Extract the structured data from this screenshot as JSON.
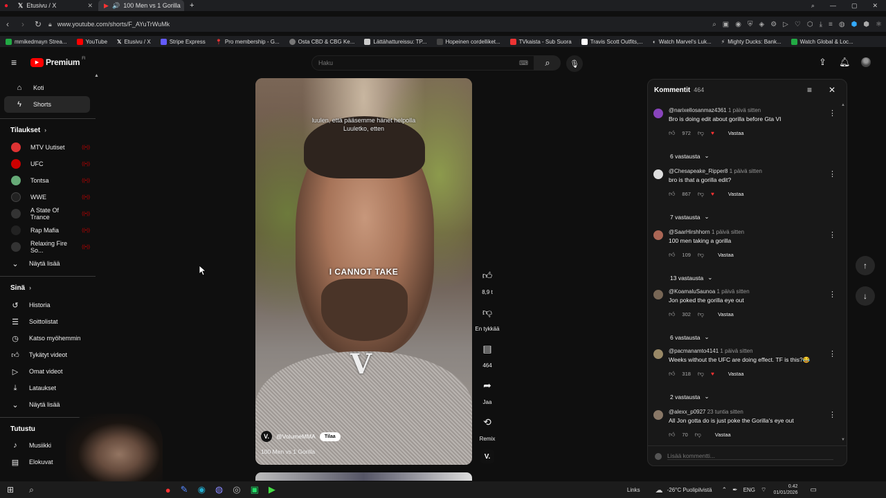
{
  "browser": {
    "tabs": [
      {
        "label": "Etusivu / X",
        "active": false
      },
      {
        "label": "100 Men vs 1 Gorilla",
        "active": true
      }
    ],
    "url": "www.youtube.com/shorts/F_AYuTrWuMk",
    "bookmarks": [
      {
        "label": "mmikedmayn Strea...",
        "color": "#22aa44"
      },
      {
        "label": "YouTube",
        "color": "#ff0000"
      },
      {
        "label": "Etusivu / X",
        "color": "#ffffff"
      },
      {
        "label": "Stripe Express",
        "color": "#635bff"
      },
      {
        "label": "Pro membership - G...",
        "color": "#e33"
      },
      {
        "label": "Osta CBD & CBG Ke...",
        "color": "#777"
      },
      {
        "label": "Lättähattureissu: TP...",
        "color": "#ccc"
      },
      {
        "label": "Hopeinen cordelliket...",
        "color": "#333"
      },
      {
        "label": "TVkaista - Sub Suora",
        "color": "#e33"
      },
      {
        "label": "Travis Scott Outfits,...",
        "color": "#fff"
      },
      {
        "label": "Watch Marvel's Luk...",
        "color": "#ccc"
      },
      {
        "label": "Mighty Ducks: Bank...",
        "color": "#ccc"
      },
      {
        "label": "Watch Global & Loc...",
        "color": "#2a4"
      }
    ]
  },
  "youtube": {
    "logo_text": "Premium",
    "logo_sup": "FI",
    "search_placeholder": "Haku"
  },
  "sidebar": {
    "main": [
      {
        "label": "Koti",
        "icon": "home-icon",
        "active": false
      },
      {
        "label": "Shorts",
        "icon": "shorts-icon",
        "active": true
      }
    ],
    "subs_heading": "Tilaukset",
    "subs": [
      {
        "label": "MTV Uutiset",
        "color": "#d33"
      },
      {
        "label": "UFC",
        "color": "#c00"
      },
      {
        "label": "Tontsa",
        "color": "#6a7"
      },
      {
        "label": "WWE",
        "color": "#222"
      },
      {
        "label": "A State Of Trance",
        "color": "#333"
      },
      {
        "label": "Rap Mafia",
        "color": "#222"
      },
      {
        "label": "Relaxing Fire So...",
        "color": "#333"
      }
    ],
    "show_more": "Näytä lisää",
    "you_heading": "Sinä",
    "you": [
      {
        "label": "Historia",
        "icon": "history-icon"
      },
      {
        "label": "Soittolistat",
        "icon": "playlist-icon"
      },
      {
        "label": "Katso myöhemmin",
        "icon": "clock-icon"
      },
      {
        "label": "Tykätyt videot",
        "icon": "like-icon"
      },
      {
        "label": "Omat videot",
        "icon": "video-icon"
      },
      {
        "label": "Lataukset",
        "icon": "download-icon"
      }
    ],
    "show_more_2": "Näytä lisää",
    "explore_heading": "Tutustu",
    "explore": [
      {
        "label": "Musiikki",
        "icon": "music-icon"
      },
      {
        "label": "Elokuvat",
        "icon": "film-icon"
      }
    ]
  },
  "video": {
    "subtitle_line1": "luulen, että pääsemme hänet helpolla",
    "subtitle_line2": "Luuletko, etten",
    "caption": "I CANNOT TAKE",
    "channel": "@VolumeMMA",
    "subscribe": "Tilaa",
    "title": "100 Men vs 1 Gorilla"
  },
  "actions": {
    "likes": "8,9 t",
    "dislike": "En tykkää",
    "comments": "464",
    "share": "Jaa",
    "remix": "Remix"
  },
  "comments_panel": {
    "title": "Kommentit",
    "count": "464",
    "add_placeholder": "Lisää kommentti...",
    "reply_label": "Vastaa",
    "items": [
      {
        "author": "@narixellosanmaz4361",
        "time": "1 päivä sitten",
        "text": "Bro is doing edit about gorilla before Gta VI",
        "likes": "972",
        "replies": "6 vastausta",
        "heart": true,
        "color": "#8844bb"
      },
      {
        "author": "@Chesapeake_Ripper8",
        "time": "1 päivä sitten",
        "text": "bro is that a gorilla edit?",
        "likes": "867",
        "replies": "7 vastausta",
        "heart": true,
        "color": "#dddddd"
      },
      {
        "author": "@SaarHirshhorn",
        "time": "1 päivä sitten",
        "text": "100 men taking a gorilla",
        "likes": "109",
        "replies": "13 vastausta",
        "heart": false,
        "color": "#aa6655"
      },
      {
        "author": "@KoamaluSaunoa",
        "time": "1 päivä sitten",
        "text": "Jon poked the gorilla eye out",
        "likes": "302",
        "replies": "6 vastausta",
        "heart": false,
        "color": "#776655"
      },
      {
        "author": "@pacmanamto4141",
        "time": "1 päivä sitten",
        "text": "Weeks without the UFC are doing effect. TF is this?😂",
        "likes": "318",
        "replies": "2 vastausta",
        "heart": true,
        "color": "#998866"
      },
      {
        "author": "@alexx_p0927",
        "time": "23 tuntia sitten",
        "text": "All Jon gotta do is just poke the Gorilla's eye out",
        "likes": "70",
        "replies": "",
        "heart": false,
        "color": "#887766"
      }
    ]
  },
  "taskbar": {
    "links": "Links",
    "weather": "-26°C Puolipilvistä",
    "lang": "ENG",
    "time": "0.42",
    "date": "01/01/2026"
  }
}
